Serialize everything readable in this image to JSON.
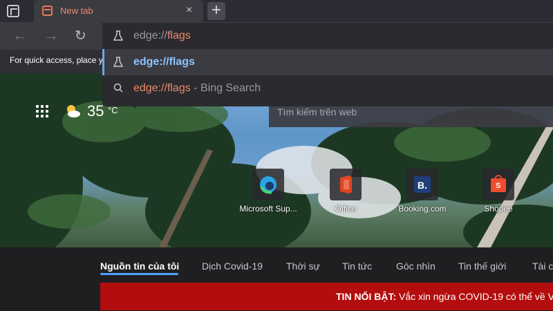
{
  "tab": {
    "title": "New tab",
    "close_glyph": "×"
  },
  "new_tab_glyph": "+",
  "nav": {
    "back": "←",
    "forward": "→",
    "refresh": "↻"
  },
  "favorites_hint": "For quick access, place y",
  "omnibox": {
    "input_prefix": "edge://",
    "input_suffix": "flags",
    "suggestion_selected": "edge://flags",
    "suggestion_bing_prefix": "edge://flags",
    "suggestion_bing_suffix": "- Bing Search"
  },
  "search": {
    "placeholder": "Tìm kiếm trên web"
  },
  "weather": {
    "temp": "35",
    "unit": "°C"
  },
  "quick_links": [
    {
      "label": "Microsoft Sup...",
      "icon": "edge-icon",
      "color": "#2aa4e6"
    },
    {
      "label": "Office",
      "icon": "office-icon",
      "color": "#e2451f"
    },
    {
      "label": "Booking.com",
      "icon": "booking-icon",
      "color": "#1f3f7a",
      "glyph": "B."
    },
    {
      "label": "Shopee",
      "icon": "shopee-icon",
      "color": "#ee4d2d"
    }
  ],
  "news_tabs": [
    "Nguồn tin của tôi",
    "Dịch Covid-19",
    "Thời sự",
    "Tin tức",
    "Góc nhìn",
    "Tin thế giới",
    "Tài c"
  ],
  "breaking": {
    "label": "TIN NỔI BẬT:",
    "text": "Vắc xin ngừa COVID-19 có thể về V"
  }
}
